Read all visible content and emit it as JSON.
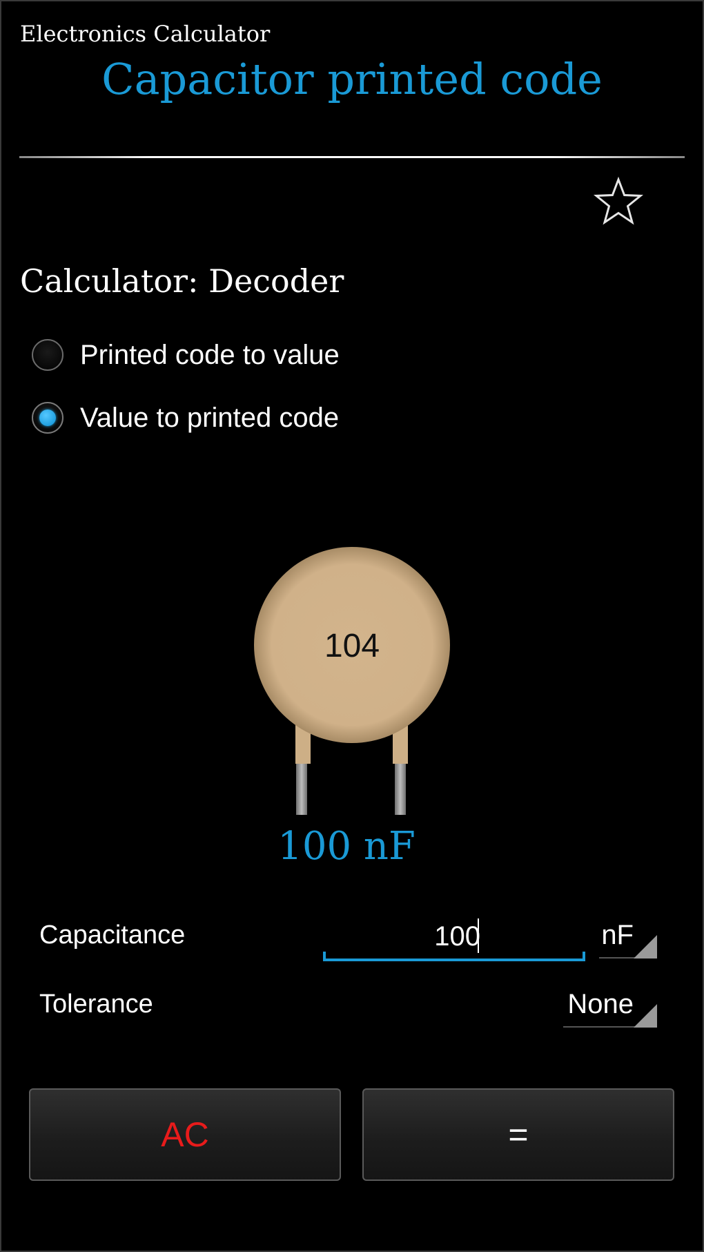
{
  "header": {
    "app_name": "Electronics Calculator",
    "page_title": "Capacitor printed code",
    "favorite_icon": "star-outline-icon"
  },
  "calculator": {
    "label": "Calculator: Decoder",
    "options": [
      {
        "label": "Printed code to value",
        "checked": false
      },
      {
        "label": "Value to printed code",
        "checked": true
      }
    ]
  },
  "capacitor": {
    "printed_code": "104",
    "value_text": "100 nF",
    "body_color": "#d2b48c"
  },
  "form": {
    "capacitance": {
      "label": "Capacitance",
      "value": "100",
      "unit": "nF"
    },
    "tolerance": {
      "label": "Tolerance",
      "value": "None"
    }
  },
  "buttons": {
    "ac_label": "AC",
    "equals_label": "="
  },
  "colors": {
    "accent": "#1a9ad6",
    "ac_red": "#e81b1b",
    "background": "#000000"
  }
}
